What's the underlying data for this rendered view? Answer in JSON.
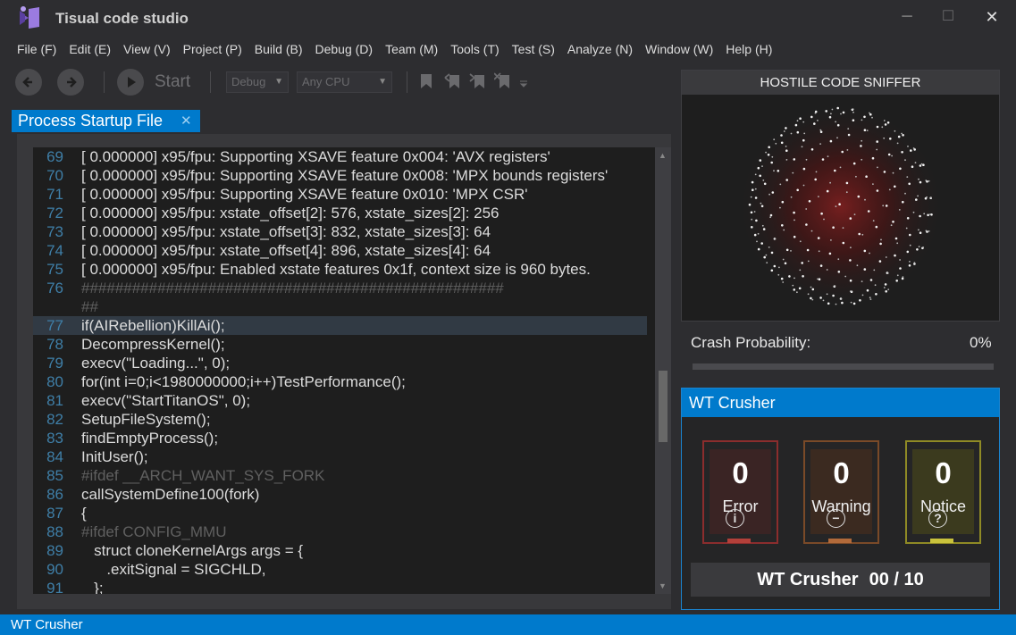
{
  "app": {
    "title": "Tisual code studio"
  },
  "window_controls": {
    "minimize": "─",
    "maximize": "☐",
    "close": "✕"
  },
  "menu": [
    "File (F)",
    "Edit (E)",
    "View (V)",
    "Project (P)",
    "Build (B)",
    "Debug (D)",
    "Team (M)",
    "Tools (T)",
    "Test (S)",
    "Analyze (N)",
    "Window (W)",
    "Help (H)"
  ],
  "toolbar": {
    "start_label": "Start",
    "config": "Debug",
    "platform": "Any CPU",
    "icons": [
      "back-arrow-icon",
      "forward-arrow-icon",
      "play-icon",
      "bookmark-icon",
      "bookmark-prev-icon",
      "bookmark-next-icon",
      "bookmark-clear-icon",
      "overflow-caret-icon"
    ]
  },
  "tab": {
    "label": "Process Startup File",
    "close": "✕"
  },
  "editor": {
    "lines": [
      {
        "n": "69",
        "text": "[ 0.000000] x95/fpu: Supporting XSAVE feature 0x004: 'AVX registers'"
      },
      {
        "n": "70",
        "text": "[ 0.000000] x95/fpu: Supporting XSAVE feature 0x008: 'MPX bounds registers'"
      },
      {
        "n": "71",
        "text": "[ 0.000000] x95/fpu: Supporting XSAVE feature 0x010: 'MPX CSR'"
      },
      {
        "n": "72",
        "text": "[ 0.000000] x95/fpu: xstate_offset[2]: 576, xstate_sizes[2]: 256"
      },
      {
        "n": "73",
        "text": "[ 0.000000] x95/fpu: xstate_offset[3]: 832, xstate_sizes[3]: 64"
      },
      {
        "n": "74",
        "text": "[ 0.000000] x95/fpu: xstate_offset[4]: 896, xstate_sizes[4]: 64"
      },
      {
        "n": "75",
        "text": "[ 0.000000] x95/fpu: Enabled xstate features 0x1f, context size is 960 bytes."
      },
      {
        "n": "76",
        "text": "##################################################",
        "comment": true
      },
      {
        "n": "",
        "text": "##",
        "comment": true
      },
      {
        "n": "77",
        "text": "if(AIRebellion)KillAi();",
        "highlight": true
      },
      {
        "n": "78",
        "text": "DecompressKernel();"
      },
      {
        "n": "79",
        "text": "execv(\"Loading...\", 0);"
      },
      {
        "n": "80",
        "text": "for(int i=0;i<1980000000;i++)TestPerformance();"
      },
      {
        "n": "81",
        "text": "execv(\"StartTitanOS\", 0);"
      },
      {
        "n": "82",
        "text": "SetupFileSystem();"
      },
      {
        "n": "83",
        "text": "findEmptyProcess();"
      },
      {
        "n": "84",
        "text": "InitUser();"
      },
      {
        "n": "85",
        "text": "#ifdef __ARCH_WANT_SYS_FORK",
        "comment": true
      },
      {
        "n": "86",
        "text": "callSystemDefine100(fork)"
      },
      {
        "n": "87",
        "text": "{"
      },
      {
        "n": "88",
        "text": "#ifdef CONFIG_MMU",
        "comment": true
      },
      {
        "n": "89",
        "text": "   struct cloneKernelArgs args = {"
      },
      {
        "n": "90",
        "text": "      .exitSignal = SIGCHLD,"
      },
      {
        "n": "91",
        "text": "   };"
      }
    ]
  },
  "sniffer": {
    "title": "HOSTILE CODE SNIFFER",
    "crash_label": "Crash Probability:",
    "crash_value": "0%",
    "crash_fraction": 0
  },
  "crusher": {
    "title": "WT Crusher",
    "cards": [
      {
        "count": "0",
        "label": "Error",
        "icon": "info-icon",
        "glyph": "i",
        "border": "#8b2d2d",
        "bg": "#3a2424",
        "foot": "#b3403a"
      },
      {
        "count": "0",
        "label": "Warning",
        "icon": "minus-circle-icon",
        "glyph": "−",
        "border": "#7a4a28",
        "bg": "#3b2a20",
        "foot": "#b26a3a"
      },
      {
        "count": "0",
        "label": "Notice",
        "icon": "question-icon",
        "glyph": "?",
        "border": "#8f8a25",
        "bg": "#3b3a1e",
        "foot": "#c9c23c"
      }
    ],
    "footer_label": "WT Crusher",
    "footer_count": "00 / 10"
  },
  "statusbar": {
    "text": "WT Crusher"
  },
  "colors": {
    "accent": "#007acc",
    "background": "#2d2d30",
    "editor_bg": "#1e1e1e"
  }
}
